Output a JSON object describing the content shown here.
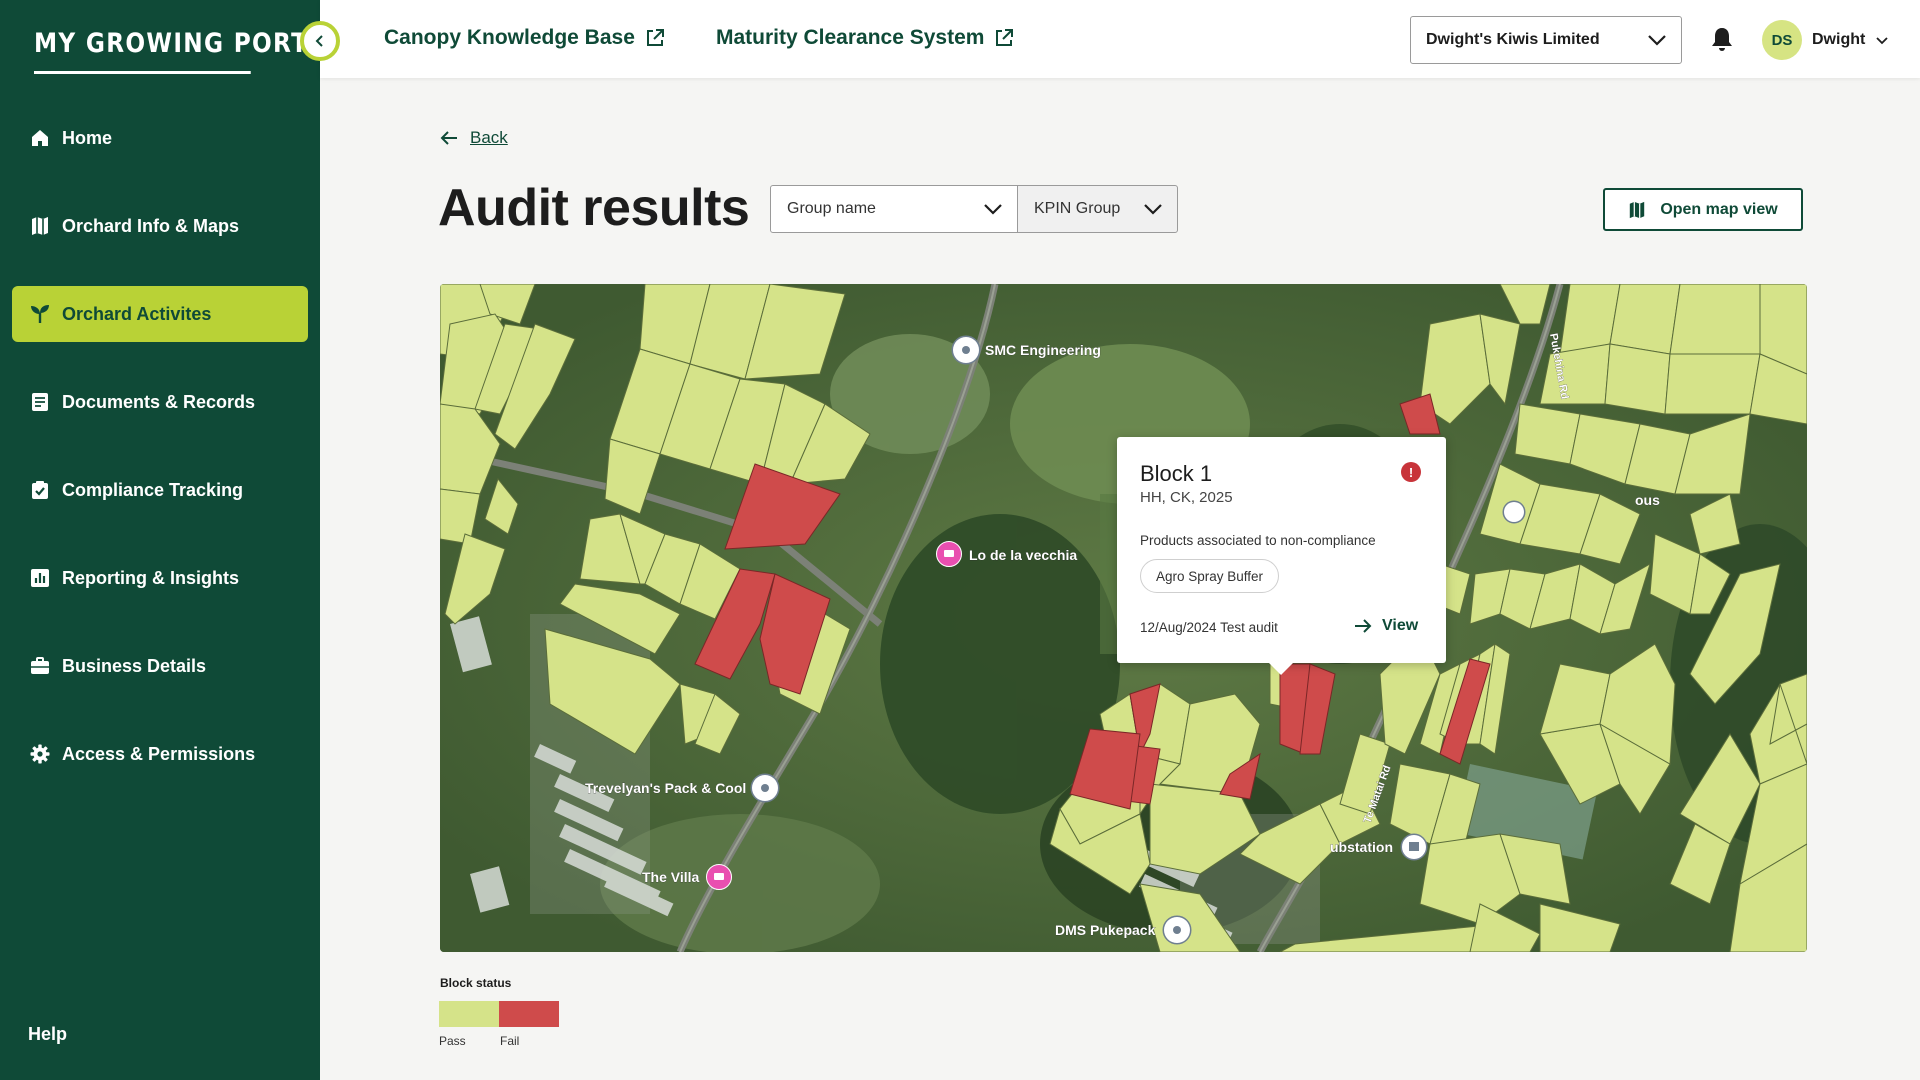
{
  "sidebar": {
    "logo": "MY GROWING PORTAL",
    "items": [
      {
        "label": "Home",
        "icon": "home-icon"
      },
      {
        "label": "Orchard Info & Maps",
        "icon": "map-icon"
      },
      {
        "label": "Orchard Activites",
        "icon": "sprout-icon",
        "active": true
      },
      {
        "label": "Documents & Records",
        "icon": "document-icon"
      },
      {
        "label": "Compliance Tracking",
        "icon": "clipboard-check-icon"
      },
      {
        "label": "Reporting & Insights",
        "icon": "bar-chart-icon"
      },
      {
        "label": "Business Details",
        "icon": "briefcase-icon"
      },
      {
        "label": "Access & Permissions",
        "icon": "gear-icon"
      }
    ],
    "help": "Help"
  },
  "header": {
    "links": [
      "Canopy Knowledge Base",
      "Maturity Clearance System"
    ],
    "organisation": "Dwight's Kiwis Limited",
    "user_initials": "DS",
    "user_name": "Dwight"
  },
  "main": {
    "back": "Back",
    "title": "Audit results",
    "filters": {
      "group": "Group name",
      "kpin": "KPIN Group"
    },
    "open_map": "Open map view"
  },
  "map": {
    "places": [
      "SMC Engineering",
      "Lo de la vecchia",
      "Trevelyan's Pack & Cool",
      "The Villa",
      "DMS Pukepack",
      "ubstation",
      "ous",
      "Te Matai Rd",
      "Pukehina Rd"
    ],
    "popup": {
      "title": "Block 1",
      "subtitle": "HH, CK, 2025",
      "alert": "!",
      "label": "Products associated to non-compliance",
      "product": "Agro Spray Buffer",
      "audit": "12/Aug/2024 Test audit",
      "view": "View"
    }
  },
  "legend": {
    "title": "Block status",
    "pass": "Pass",
    "fail": "Fail",
    "colors": {
      "pass": "#d5e389",
      "fail": "#cf4b4b"
    }
  }
}
